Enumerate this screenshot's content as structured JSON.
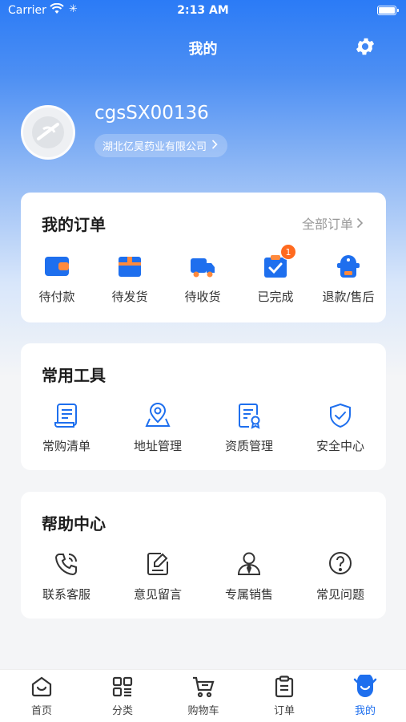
{
  "status_bar": {
    "carrier": "Carrier",
    "time": "2:13 AM"
  },
  "header": {
    "title": "我的"
  },
  "profile": {
    "username": "cgsSX00136",
    "company": "湖北亿昊药业有限公司"
  },
  "orders": {
    "title": "我的订单",
    "all_label": "全部订单",
    "items": [
      {
        "label": "待付款",
        "icon": "wallet-icon"
      },
      {
        "label": "待发货",
        "icon": "box-icon"
      },
      {
        "label": "待收货",
        "icon": "truck-icon"
      },
      {
        "label": "已完成",
        "icon": "check-clipboard-icon",
        "badge": "1"
      },
      {
        "label": "退款/售后",
        "icon": "after-sales-icon"
      }
    ]
  },
  "tools": {
    "title": "常用工具",
    "items": [
      {
        "label": "常购清单",
        "icon": "list-scroll-icon"
      },
      {
        "label": "地址管理",
        "icon": "location-pin-icon"
      },
      {
        "label": "资质管理",
        "icon": "certificate-icon"
      },
      {
        "label": "安全中心",
        "icon": "shield-check-icon"
      }
    ]
  },
  "help": {
    "title": "帮助中心",
    "items": [
      {
        "label": "联系客服",
        "icon": "phone-icon"
      },
      {
        "label": "意见留言",
        "icon": "feedback-edit-icon"
      },
      {
        "label": "专属销售",
        "icon": "sales-person-icon"
      },
      {
        "label": "常见问题",
        "icon": "question-icon"
      }
    ]
  },
  "tabbar": {
    "items": [
      {
        "label": "首页",
        "icon": "home-icon"
      },
      {
        "label": "分类",
        "icon": "category-icon"
      },
      {
        "label": "购物车",
        "icon": "cart-icon"
      },
      {
        "label": "订单",
        "icon": "order-clipboard-icon"
      },
      {
        "label": "我的",
        "icon": "profile-smile-icon",
        "active": true
      }
    ]
  },
  "colors": {
    "primary": "#1e6fee",
    "badge": "#ff6a1f",
    "accent_orange": "#ff8a3d"
  }
}
